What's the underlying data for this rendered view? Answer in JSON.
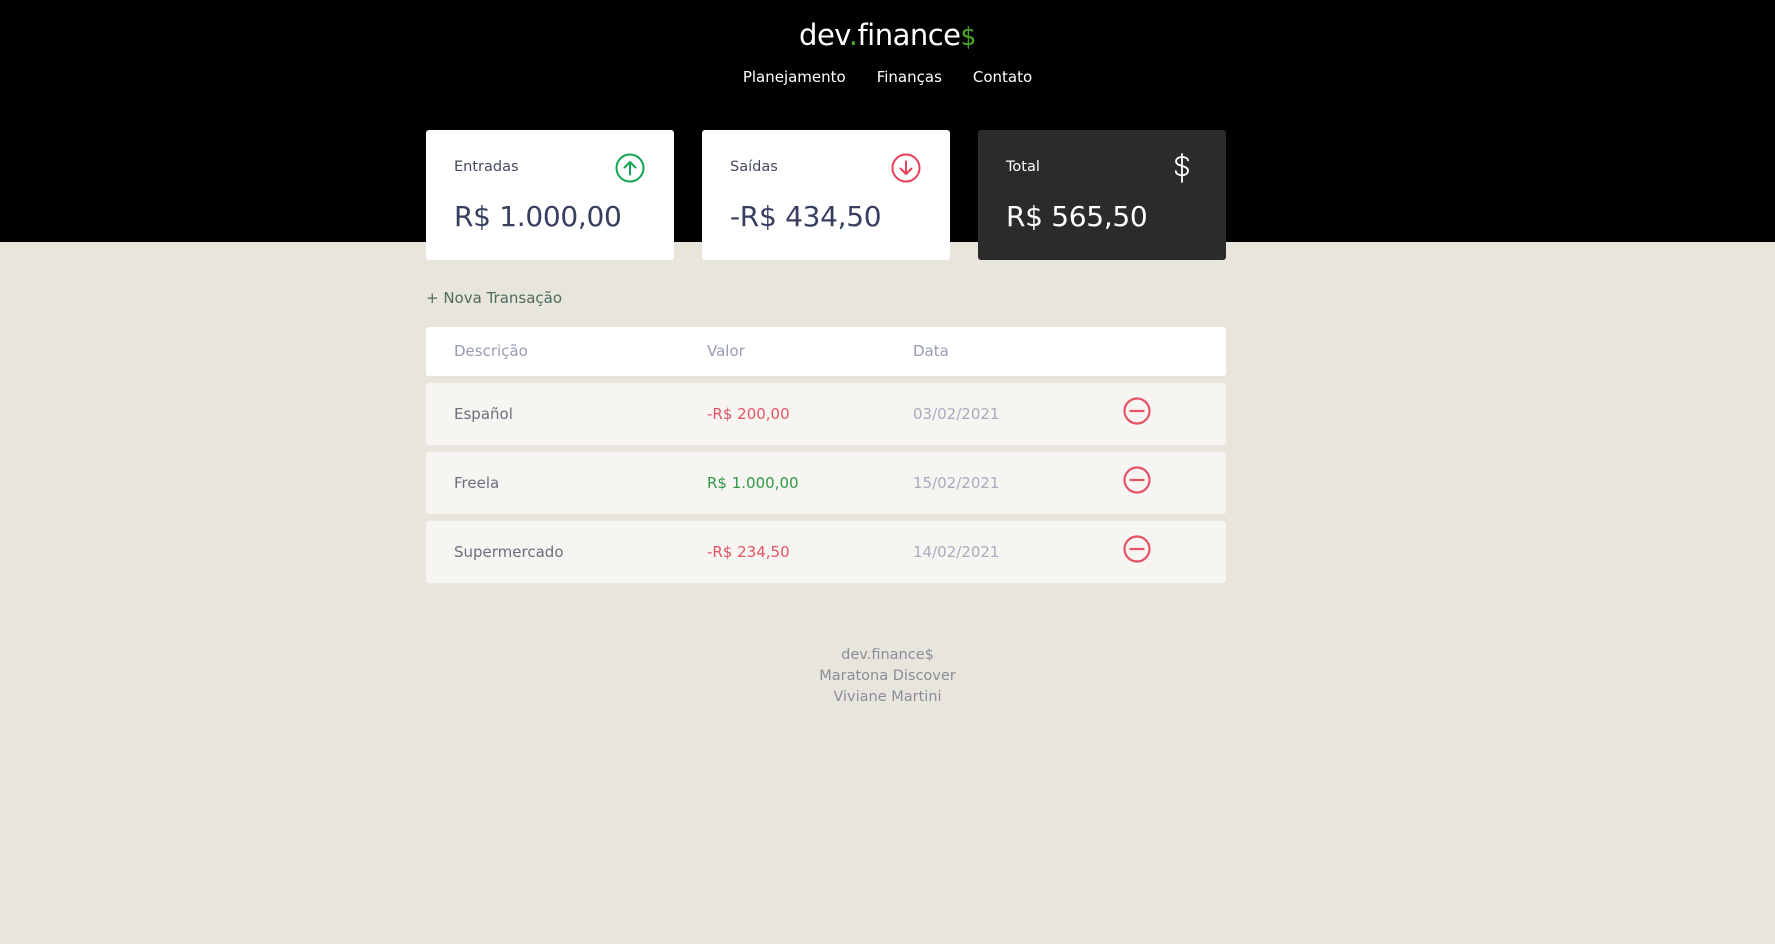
{
  "header": {
    "logo_prefix": "dev",
    "logo_dot": ".",
    "logo_name": "finance",
    "logo_suffix": "$",
    "nav": [
      "Planejamento",
      "Finanças",
      "Contato"
    ]
  },
  "cards": {
    "income": {
      "title": "Entradas",
      "value": "R$ 1.000,00",
      "icon": "arrow-up-circle-icon"
    },
    "expense": {
      "title": "Saídas",
      "value": "-R$ 434,50",
      "icon": "arrow-down-circle-icon"
    },
    "total": {
      "title": "Total",
      "value": "R$ 565,50",
      "icon": "dollar-icon"
    }
  },
  "actions": {
    "new_transaction": "+ Nova Transação"
  },
  "table": {
    "headers": [
      "Descrição",
      "Valor",
      "Data"
    ],
    "rows": [
      {
        "description": "Español",
        "amount": "-R$ 200,00",
        "date": "03/02/2021",
        "type": "expense"
      },
      {
        "description": "Freela",
        "amount": "R$ 1.000,00",
        "date": "15/02/2021",
        "type": "income"
      },
      {
        "description": "Supermercado",
        "amount": "-R$ 234,50",
        "date": "14/02/2021",
        "type": "expense"
      }
    ]
  },
  "footer": {
    "lines": [
      "dev.finance$",
      "Maratona Discover",
      "Viviane Martini"
    ]
  },
  "colors": {
    "brand_green": "#49aa26",
    "expense_red": "#e55366",
    "income_green": "#2f9a48",
    "header_bg": "#000000",
    "page_bg": "#e8e6dc"
  }
}
